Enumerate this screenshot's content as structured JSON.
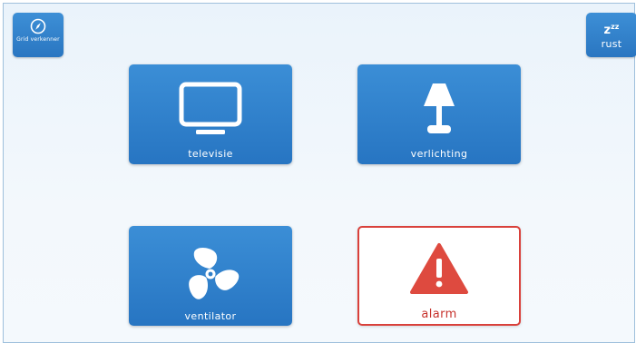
{
  "corner_buttons": {
    "grid": {
      "label": "Grid verkenner",
      "icon": "compass-icon"
    },
    "rest": {
      "label": "rust",
      "icon_text": "z",
      "icon_sup": "zz"
    }
  },
  "tiles": [
    {
      "label": "televisie",
      "icon": "tv-icon"
    },
    {
      "label": "verlichting",
      "icon": "lamp-icon"
    },
    {
      "label": "ventilator",
      "icon": "fan-icon"
    },
    {
      "label": "alarm",
      "icon": "warning-icon"
    }
  ],
  "colors": {
    "tile_blue": "#2f80cc",
    "alarm_red": "#d9413b",
    "background": "#eef5fb"
  }
}
